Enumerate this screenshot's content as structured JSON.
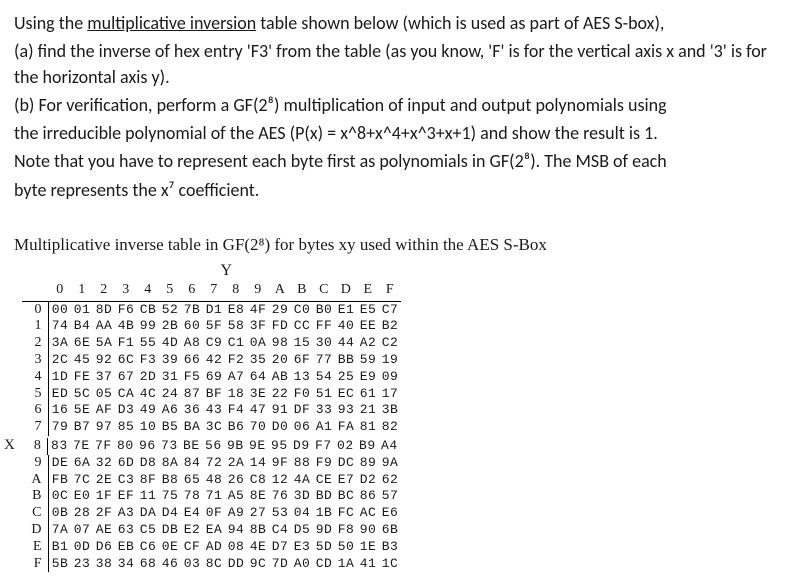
{
  "problem": {
    "intro_pre": "Using the ",
    "intro_underlined": "multiplicative inversion",
    "intro_post": " table shown below (which is used as part of AES S-box),",
    "part_a": "(a) find the inverse of hex entry 'F3' from the table (as you know, 'F' is for the vertical axis x and '3' is for the horizontal axis y).",
    "part_b_line1": "(b) For verification, perform a GF(2⁸) multiplication of input and output polynomials using",
    "part_b_line2": "the irreducible polynomial of the AES (P(x) = x^8+x^4+x^3+x+1) and show the result is 1.",
    "note_line1": "Note that you have to represent each byte first as polynomials in GF(2⁸). The MSB of each",
    "note_line2": "byte represents the x⁷ coefficient."
  },
  "table": {
    "caption": "Multiplicative inverse table in GF(2⁸) for bytes xy used within the AES S-Box",
    "y_label": "Y",
    "x_axis_label": "X",
    "col_headers": [
      "0",
      "1",
      "2",
      "3",
      "4",
      "5",
      "6",
      "7",
      "8",
      "9",
      "A",
      "B",
      "C",
      "D",
      "E",
      "F"
    ],
    "row_headers": [
      "0",
      "1",
      "2",
      "3",
      "4",
      "5",
      "6",
      "7",
      "8",
      "9",
      "A",
      "B",
      "C",
      "D",
      "E",
      "F"
    ],
    "rows": [
      [
        "00",
        "01",
        "8D",
        "F6",
        "CB",
        "52",
        "7B",
        "D1",
        "E8",
        "4F",
        "29",
        "C0",
        "B0",
        "E1",
        "E5",
        "C7"
      ],
      [
        "74",
        "B4",
        "AA",
        "4B",
        "99",
        "2B",
        "60",
        "5F",
        "58",
        "3F",
        "FD",
        "CC",
        "FF",
        "40",
        "EE",
        "B2"
      ],
      [
        "3A",
        "6E",
        "5A",
        "F1",
        "55",
        "4D",
        "A8",
        "C9",
        "C1",
        "0A",
        "98",
        "15",
        "30",
        "44",
        "A2",
        "C2"
      ],
      [
        "2C",
        "45",
        "92",
        "6C",
        "F3",
        "39",
        "66",
        "42",
        "F2",
        "35",
        "20",
        "6F",
        "77",
        "BB",
        "59",
        "19"
      ],
      [
        "1D",
        "FE",
        "37",
        "67",
        "2D",
        "31",
        "F5",
        "69",
        "A7",
        "64",
        "AB",
        "13",
        "54",
        "25",
        "E9",
        "09"
      ],
      [
        "ED",
        "5C",
        "05",
        "CA",
        "4C",
        "24",
        "87",
        "BF",
        "18",
        "3E",
        "22",
        "F0",
        "51",
        "EC",
        "61",
        "17"
      ],
      [
        "16",
        "5E",
        "AF",
        "D3",
        "49",
        "A6",
        "36",
        "43",
        "F4",
        "47",
        "91",
        "DF",
        "33",
        "93",
        "21",
        "3B"
      ],
      [
        "79",
        "B7",
        "97",
        "85",
        "10",
        "B5",
        "BA",
        "3C",
        "B6",
        "70",
        "D0",
        "06",
        "A1",
        "FA",
        "81",
        "82"
      ],
      [
        "83",
        "7E",
        "7F",
        "80",
        "96",
        "73",
        "BE",
        "56",
        "9B",
        "9E",
        "95",
        "D9",
        "F7",
        "02",
        "B9",
        "A4"
      ],
      [
        "DE",
        "6A",
        "32",
        "6D",
        "D8",
        "8A",
        "84",
        "72",
        "2A",
        "14",
        "9F",
        "88",
        "F9",
        "DC",
        "89",
        "9A"
      ],
      [
        "FB",
        "7C",
        "2E",
        "C3",
        "8F",
        "B8",
        "65",
        "48",
        "26",
        "C8",
        "12",
        "4A",
        "CE",
        "E7",
        "D2",
        "62"
      ],
      [
        "0C",
        "E0",
        "1F",
        "EF",
        "11",
        "75",
        "78",
        "71",
        "A5",
        "8E",
        "76",
        "3D",
        "BD",
        "BC",
        "86",
        "57"
      ],
      [
        "0B",
        "28",
        "2F",
        "A3",
        "DA",
        "D4",
        "E4",
        "0F",
        "A9",
        "27",
        "53",
        "04",
        "1B",
        "FC",
        "AC",
        "E6"
      ],
      [
        "7A",
        "07",
        "AE",
        "63",
        "C5",
        "DB",
        "E2",
        "EA",
        "94",
        "8B",
        "C4",
        "D5",
        "9D",
        "F8",
        "90",
        "6B"
      ],
      [
        "B1",
        "0D",
        "D6",
        "EB",
        "C6",
        "0E",
        "CF",
        "AD",
        "08",
        "4E",
        "D7",
        "E3",
        "5D",
        "50",
        "1E",
        "B3"
      ],
      [
        "5B",
        "23",
        "38",
        "34",
        "68",
        "46",
        "03",
        "8C",
        "DD",
        "9C",
        "7D",
        "A0",
        "CD",
        "1A",
        "41",
        "1C"
      ]
    ]
  }
}
